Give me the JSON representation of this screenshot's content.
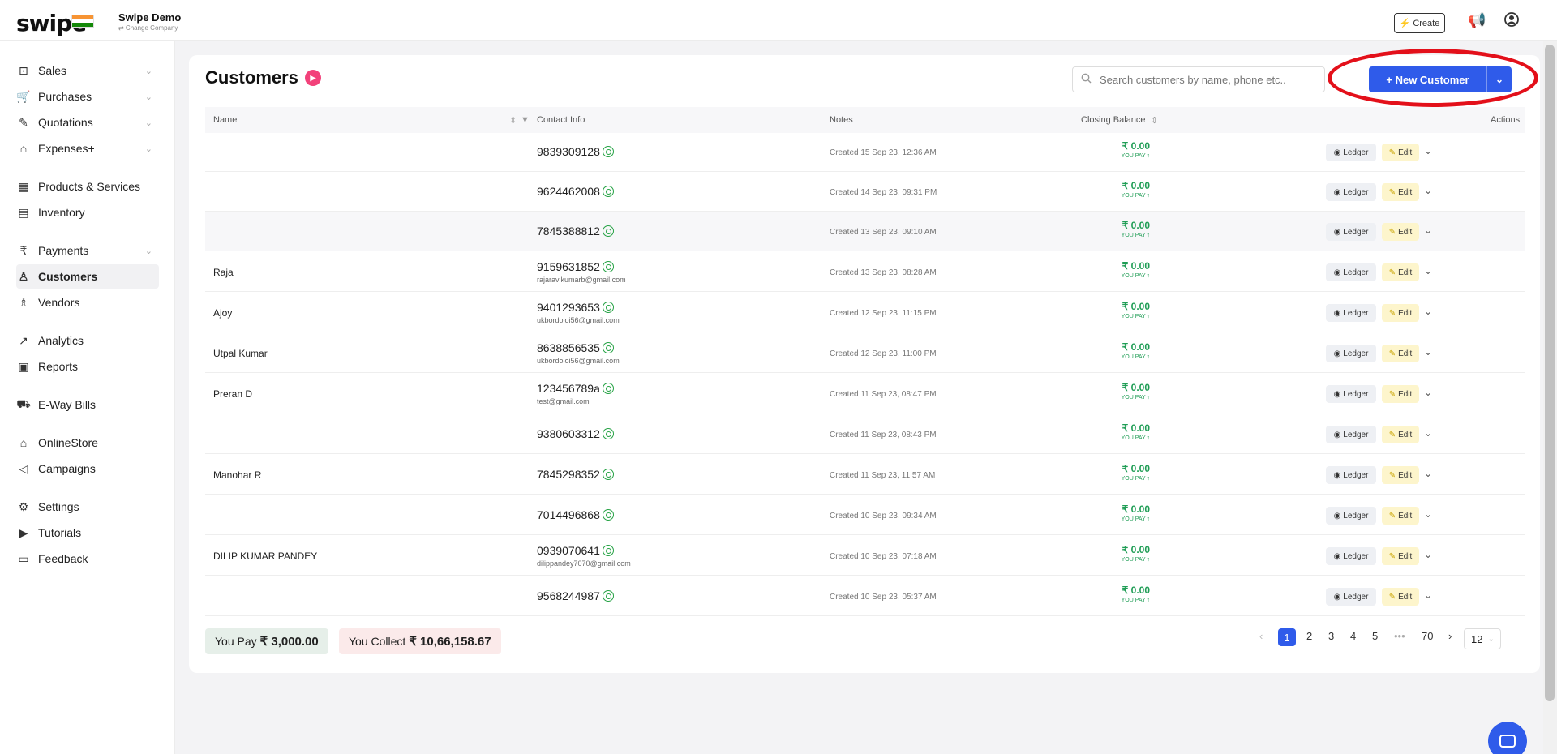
{
  "topbar": {
    "logo": "swipe",
    "company_name": "Swipe Demo",
    "change_company": "⇄ Change Company",
    "create_label": "Create",
    "create_icon": "⚡"
  },
  "sidebar": {
    "items": [
      {
        "label": "Sales",
        "icon": "⊡"
      },
      {
        "label": "Purchases",
        "icon": "🛒"
      },
      {
        "label": "Quotations",
        "icon": "✎"
      },
      {
        "label": "Expenses+",
        "icon": "⌂"
      },
      {
        "label": "Products & Services",
        "icon": "▦"
      },
      {
        "label": "Inventory",
        "icon": "▤"
      },
      {
        "label": "Payments",
        "icon": "₹"
      },
      {
        "label": "Customers",
        "icon": "♙"
      },
      {
        "label": "Vendors",
        "icon": "♗"
      },
      {
        "label": "Analytics",
        "icon": "↗"
      },
      {
        "label": "Reports",
        "icon": "▣"
      },
      {
        "label": "E-Way Bills",
        "icon": "⛟"
      },
      {
        "label": "OnlineStore",
        "icon": "⌂"
      },
      {
        "label": "Campaigns",
        "icon": "◁"
      },
      {
        "label": "Settings",
        "icon": "⚙"
      },
      {
        "label": "Tutorials",
        "icon": "▶"
      },
      {
        "label": "Feedback",
        "icon": "▭"
      }
    ]
  },
  "main": {
    "title": "Customers",
    "search_placeholder": "Search customers by name, phone etc..",
    "new_button": "+ New Customer",
    "columns": {
      "name": "Name",
      "contact": "Contact Info",
      "notes": "Notes",
      "balance": "Closing Balance",
      "actions": "Actions"
    },
    "ledger_label": "Ledger",
    "edit_label": "Edit",
    "rows": [
      {
        "name": "",
        "phone": "9839309128",
        "email": "",
        "note": "Created 15 Sep 23, 12:36 AM",
        "balance": "₹ 0.00",
        "status": "YOU PAY ↑"
      },
      {
        "name": "",
        "phone": "9624462008",
        "email": "",
        "note": "Created 14 Sep 23, 09:31 PM",
        "balance": "₹ 0.00",
        "status": "YOU PAY ↑"
      },
      {
        "name": "",
        "phone": "7845388812",
        "email": "",
        "note": "Created 13 Sep 23, 09:10 AM",
        "balance": "₹ 0.00",
        "status": "YOU PAY ↑"
      },
      {
        "name": "Raja",
        "phone": "9159631852",
        "email": "rajaravikumarb@gmail.com",
        "note": "Created 13 Sep 23, 08:28 AM",
        "balance": "₹ 0.00",
        "status": "YOU PAY ↑"
      },
      {
        "name": "Ajoy",
        "phone": "9401293653",
        "email": "ukbordoloi56@gmail.com",
        "note": "Created 12 Sep 23, 11:15 PM",
        "balance": "₹ 0.00",
        "status": "YOU PAY ↑"
      },
      {
        "name": "Utpal Kumar",
        "phone": "8638856535",
        "email": "ukbordoloi56@gmail.com",
        "note": "Created 12 Sep 23, 11:00 PM",
        "balance": "₹ 0.00",
        "status": "YOU PAY ↑"
      },
      {
        "name": "Preran D",
        "phone": "123456789a",
        "email": "test@gmail.com",
        "note": "Created 11 Sep 23, 08:47 PM",
        "balance": "₹ 0.00",
        "status": "YOU PAY ↑"
      },
      {
        "name": "",
        "phone": "9380603312",
        "email": "",
        "note": "Created 11 Sep 23, 08:43 PM",
        "balance": "₹ 0.00",
        "status": "YOU PAY ↑"
      },
      {
        "name": "Manohar R",
        "phone": "7845298352",
        "email": "",
        "note": "Created 11 Sep 23, 11:57 AM",
        "balance": "₹ 0.00",
        "status": "YOU PAY ↑"
      },
      {
        "name": "",
        "phone": "7014496868",
        "email": "",
        "note": "Created 10 Sep 23, 09:34 AM",
        "balance": "₹ 0.00",
        "status": "YOU PAY ↑"
      },
      {
        "name": "DILIP KUMAR PANDEY",
        "phone": "0939070641",
        "email": "dilippandey7070@gmail.com",
        "note": "Created 10 Sep 23, 07:18 AM",
        "balance": "₹ 0.00",
        "status": "YOU PAY ↑"
      },
      {
        "name": "",
        "phone": "9568244987",
        "email": "",
        "note": "Created 10 Sep 23, 05:37 AM",
        "balance": "₹ 0.00",
        "status": "YOU PAY ↑"
      }
    ]
  },
  "footer": {
    "you_pay_label": "You Pay",
    "you_pay_value": "₹ 3,000.00",
    "you_collect_label": "You Collect",
    "you_collect_value": "₹ 10,66,158.67",
    "pages": [
      "1",
      "2",
      "3",
      "4",
      "5",
      "•••",
      "70"
    ],
    "page_size": "12"
  },
  "colors": {
    "accent": "#2f5bea",
    "green": "#1f9d55",
    "annotation": "#e3101a"
  }
}
